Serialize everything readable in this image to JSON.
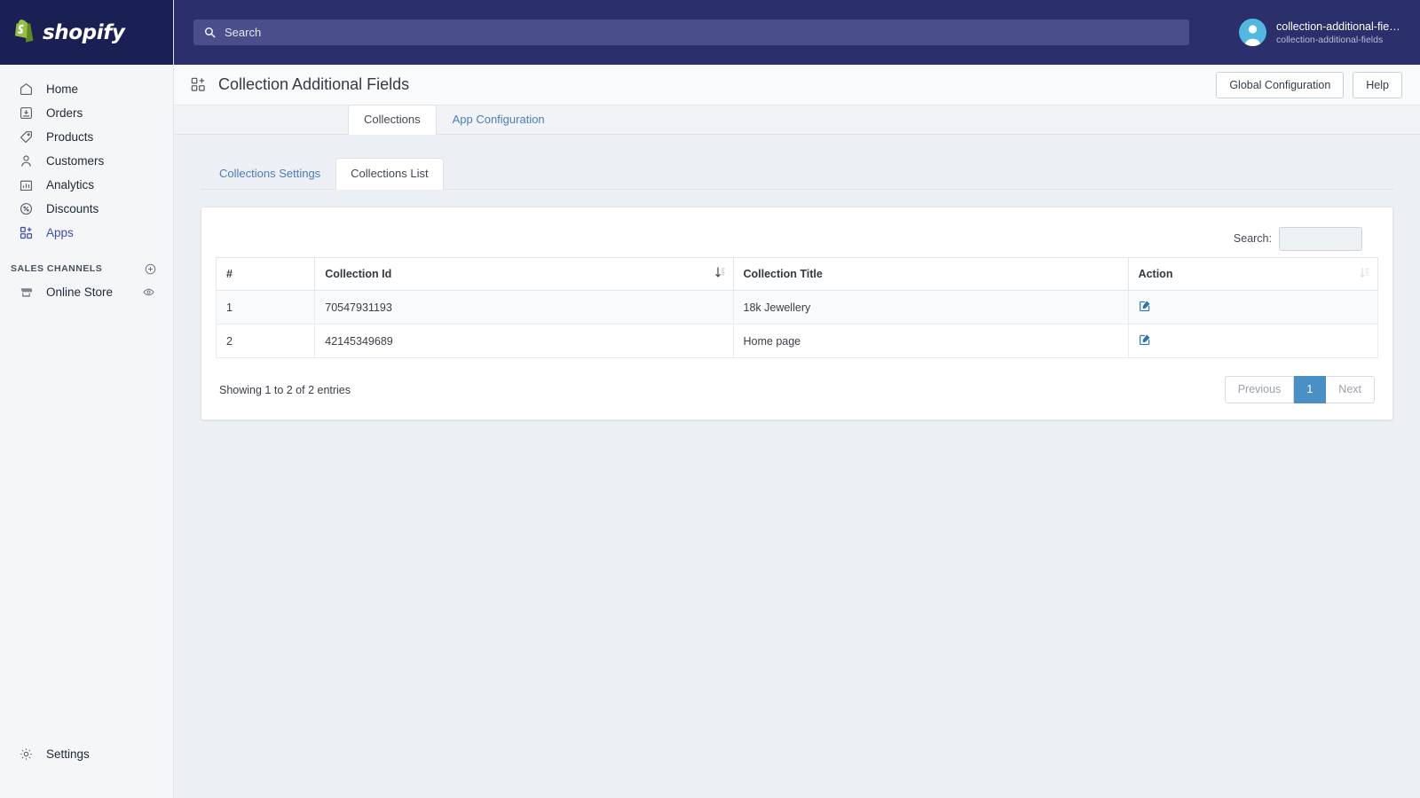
{
  "brand": {
    "name": "shopify",
    "logo_icon": "shopify-bag-icon"
  },
  "sidebar": {
    "items": [
      {
        "label": "Home",
        "icon": "home-icon",
        "active": false
      },
      {
        "label": "Orders",
        "icon": "orders-icon",
        "active": false
      },
      {
        "label": "Products",
        "icon": "tag-icon",
        "active": false
      },
      {
        "label": "Customers",
        "icon": "person-icon",
        "active": false
      },
      {
        "label": "Analytics",
        "icon": "bar-chart-icon",
        "active": false
      },
      {
        "label": "Discounts",
        "icon": "discount-icon",
        "active": false
      },
      {
        "label": "Apps",
        "icon": "apps-icon",
        "active": true
      }
    ],
    "sales_channels": {
      "title": "SALES CHANNELS",
      "add_icon": "plus-circle-icon",
      "items": [
        {
          "label": "Online Store",
          "icon": "storefront-icon",
          "action_icon": "eye-icon"
        }
      ]
    },
    "settings": {
      "label": "Settings",
      "icon": "gear-icon"
    }
  },
  "topbar": {
    "search": {
      "placeholder": "Search",
      "value": "",
      "icon": "search-icon"
    },
    "user": {
      "name": "collection-additional-fiel…",
      "subtitle": "collection-additional-fields",
      "avatar_icon": "avatar-icon"
    }
  },
  "page": {
    "title": "Collection Additional Fields",
    "title_icon": "apps-icon",
    "actions": [
      {
        "label": "Global Configuration"
      },
      {
        "label": "Help"
      }
    ],
    "primary_tabs": [
      {
        "label": "Collections",
        "active": true
      },
      {
        "label": "App Configuration",
        "active": false
      }
    ],
    "secondary_tabs": [
      {
        "label": "Collections Settings",
        "active": false
      },
      {
        "label": "Collections List",
        "active": true
      }
    ]
  },
  "datatable": {
    "search_label": "Search:",
    "search_value": "",
    "search_placeholder": "",
    "columns": [
      {
        "label": "#",
        "sortable": false,
        "sort_icon": ""
      },
      {
        "label": "Collection Id",
        "sortable": true,
        "sort_icon": "sort-asc-icon"
      },
      {
        "label": "Collection Title",
        "sortable": false,
        "sort_icon": ""
      },
      {
        "label": "Action",
        "sortable": true,
        "sort_icon": "sort-icon"
      }
    ],
    "rows": [
      {
        "index": "1",
        "collection_id": "70547931193",
        "collection_title": "18k Jewellery",
        "action_icon": "edit-square-icon"
      },
      {
        "index": "2",
        "collection_id": "42145349689",
        "collection_title": "Home page",
        "action_icon": "edit-square-icon"
      }
    ],
    "info": "Showing 1 to 2 of 2 entries",
    "pagination": [
      {
        "label": "Previous",
        "state": "disabled"
      },
      {
        "label": "1",
        "state": "active"
      },
      {
        "label": "Next",
        "state": "disabled"
      }
    ]
  },
  "colors": {
    "brand_navy": "#1a1f54",
    "topbar": "#2b2f6b",
    "accent_link": "#4c7eb8",
    "accent_active_nav": "#3f4eae",
    "pager_active": "#4a90c4",
    "edit_icon": "#2a74b5",
    "avatar": "#53b8e0",
    "page_bg": "#eceff3"
  }
}
